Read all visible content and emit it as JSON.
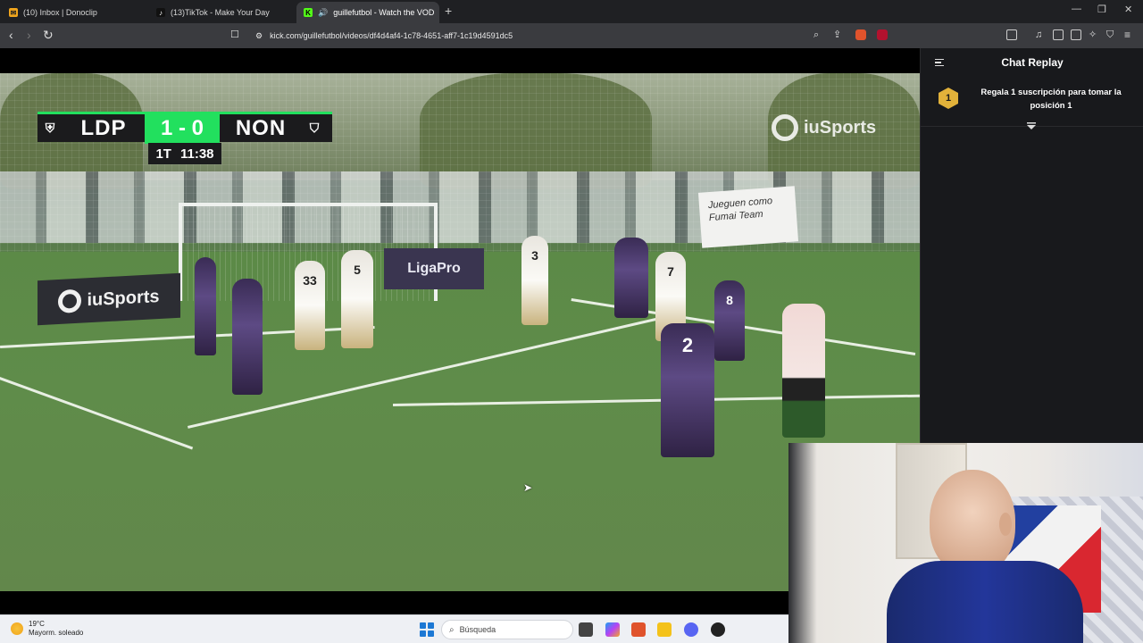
{
  "browser": {
    "tabs": [
      {
        "title": "(10) Inbox | Donoclip",
        "icon": "email-icon"
      },
      {
        "title": "(13)TikTok - Make Your Day",
        "icon": "tiktok-icon"
      },
      {
        "title": "guillefutbol - Watch the VOD",
        "icon": "kick-icon",
        "active": true
      }
    ],
    "url": "kick.com/guillefutbol/videos/df4d4af4-1c78-4651-aff7-1c19d4591dc5"
  },
  "video": {
    "scoreboard": {
      "home_team": "LDP",
      "score": "1 - 0",
      "away_team": "NON",
      "period": "1T",
      "clock": "11:38"
    },
    "watermark": "iuSports",
    "ad_banner_1": "iuSports",
    "ad_banner_2": "LigaPro",
    "sign_text": "Jueguen como Fumai Team",
    "player_numbers": [
      "33",
      "5",
      "3",
      "7",
      "2",
      "8"
    ]
  },
  "chat": {
    "title": "Chat Replay",
    "promo_rank": "1",
    "promo_text": "Regala 1 suscripción para tomar la posición 1"
  },
  "taskbar": {
    "temperature": "19°C",
    "condition": "Mayorm. soleado",
    "search_placeholder": "Búsqueda"
  },
  "colors": {
    "accent_green": "#22e05e",
    "chat_bg": "#18191c",
    "promo_badge": "#e2b23a"
  }
}
